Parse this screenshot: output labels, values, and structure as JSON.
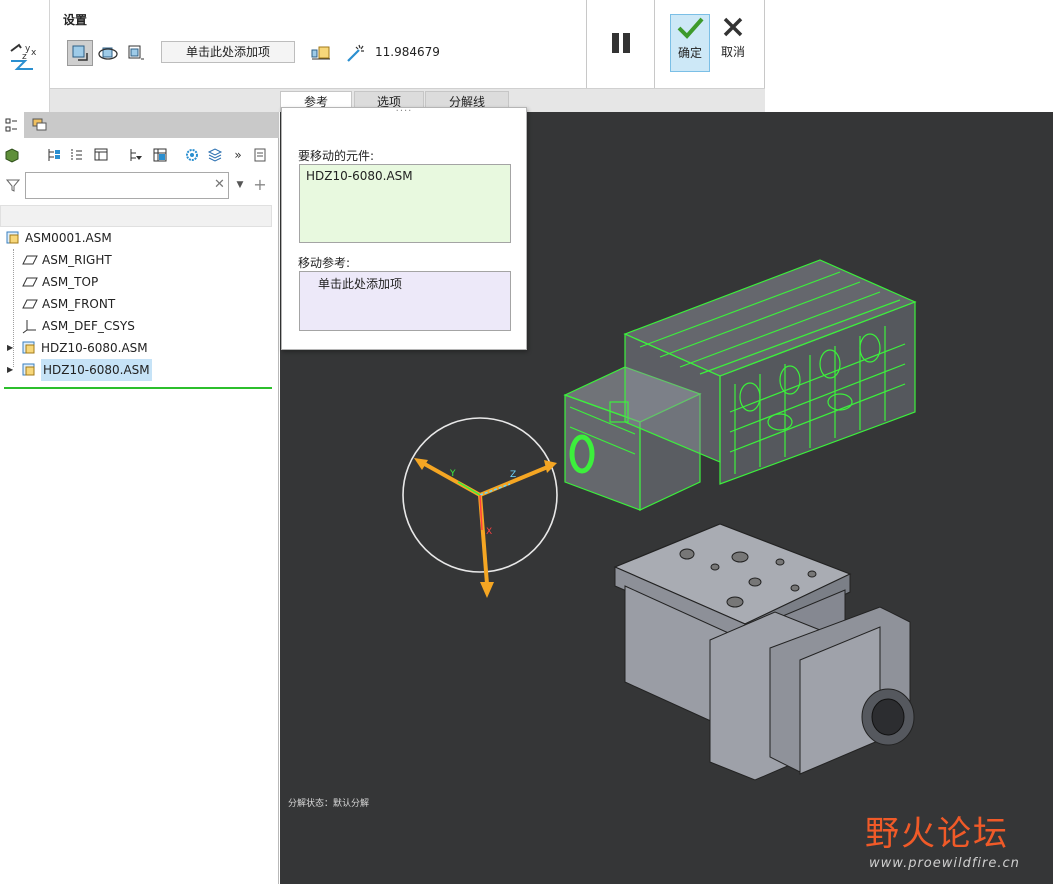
{
  "ribbon": {
    "section_title": "设置",
    "add_item_placeholder": "单击此处添加项",
    "distance_value": "11.984679",
    "ok_label": "确定",
    "cancel_label": "取消",
    "tabs": [
      {
        "label": "参考",
        "selected": true
      },
      {
        "label": "选项",
        "selected": false
      },
      {
        "label": "分解线",
        "selected": false
      }
    ]
  },
  "model_tree": {
    "filter_value": "",
    "items": [
      {
        "label": "ASM0001.ASM",
        "icon": "assembly-icon"
      },
      {
        "label": "ASM_RIGHT",
        "icon": "datum-plane-icon"
      },
      {
        "label": "ASM_TOP",
        "icon": "datum-plane-icon"
      },
      {
        "label": "ASM_FRONT",
        "icon": "datum-plane-icon"
      },
      {
        "label": "ASM_DEF_CSYS",
        "icon": "csys-icon"
      },
      {
        "label": "HDZ10-6080.ASM",
        "icon": "assembly-icon"
      },
      {
        "label": "HDZ10-6080.ASM",
        "icon": "assembly-icon",
        "selected": true
      }
    ]
  },
  "ref_panel": {
    "grip": "····",
    "components_label": "要移动的元件:",
    "components_value": "HDZ10-6080.ASM",
    "move_ref_label": "移动参考:",
    "move_ref_value": "单击此处添加项"
  },
  "viewport": {
    "explode_status": "分解状态：默认分解",
    "dragger_axes": [
      "Y",
      "Z",
      "X"
    ],
    "watermark_title": "野火论坛",
    "watermark_url": "www.proewildfire.cn",
    "background_color": "#353637",
    "highlight_color": "#3cf03c",
    "dragger_color": "#f5a623"
  }
}
